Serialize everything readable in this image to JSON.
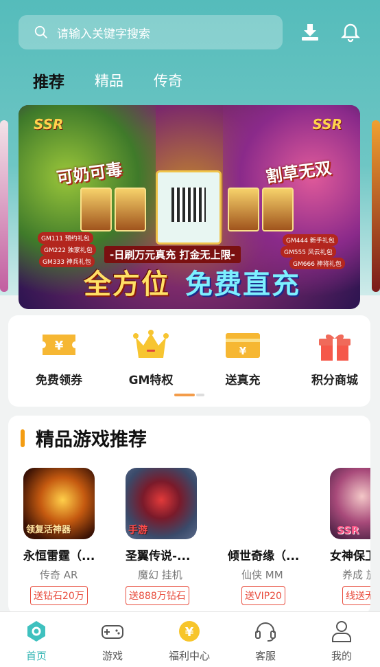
{
  "search": {
    "placeholder": "请输入关键字搜索"
  },
  "header_icons": {
    "download": "download-icon",
    "bell": "bell-icon"
  },
  "tabs": [
    {
      "label": "推荐",
      "active": true
    },
    {
      "label": "精品",
      "active": false
    },
    {
      "label": "传奇",
      "active": false
    }
  ],
  "banner": {
    "left_tag": "可奶可毒",
    "right_tag": "割草无双",
    "ssr": "SSR",
    "headline": "-日刷万元真充 打金无上限-",
    "big_text_a": "全方位",
    "big_text_b": "免费直充",
    "gm_left": [
      "GM111 预约礼包",
      "GM222 独家礼包",
      "GM333 神兵礼包"
    ],
    "gm_right": [
      "GM444 新手礼包",
      "GM555 风云礼包",
      "GM666 神将礼包"
    ]
  },
  "quick_actions": [
    {
      "label": "免费领券",
      "icon": "coupon-icon"
    },
    {
      "label": "GM特权",
      "icon": "crown-icon"
    },
    {
      "label": "送真充",
      "icon": "card-icon"
    },
    {
      "label": "积分商城",
      "icon": "gift-icon"
    }
  ],
  "section": {
    "title": "精品游戏推荐"
  },
  "games": [
    {
      "name": "永恒雷霆（...",
      "tags": "传奇  AR",
      "badge": "送钻石20万",
      "icon_text": "领复活神器"
    },
    {
      "name": "圣翼传说-...",
      "tags": "魔幻  挂机",
      "badge": "送888万钻石",
      "icon_text": "手游"
    },
    {
      "name": "倾世奇缘（...",
      "tags": "仙侠  MM",
      "badge": "送VIP20",
      "icon_text": ""
    },
    {
      "name": "女神保卫",
      "tags": "养成  放",
      "badge": "线送无",
      "icon_text": "SSR"
    }
  ],
  "nav": [
    {
      "label": "首页",
      "icon": "home-icon",
      "active": true
    },
    {
      "label": "游戏",
      "icon": "gamepad-icon",
      "active": false
    },
    {
      "label": "福利中心",
      "icon": "yen-coin-icon",
      "active": false
    },
    {
      "label": "客服",
      "icon": "headset-icon",
      "active": false
    },
    {
      "label": "我的",
      "icon": "user-icon",
      "active": false
    }
  ],
  "colors": {
    "primary": "#55bcbb",
    "accent": "#f39c12",
    "badge_red": "#e84c3d"
  }
}
